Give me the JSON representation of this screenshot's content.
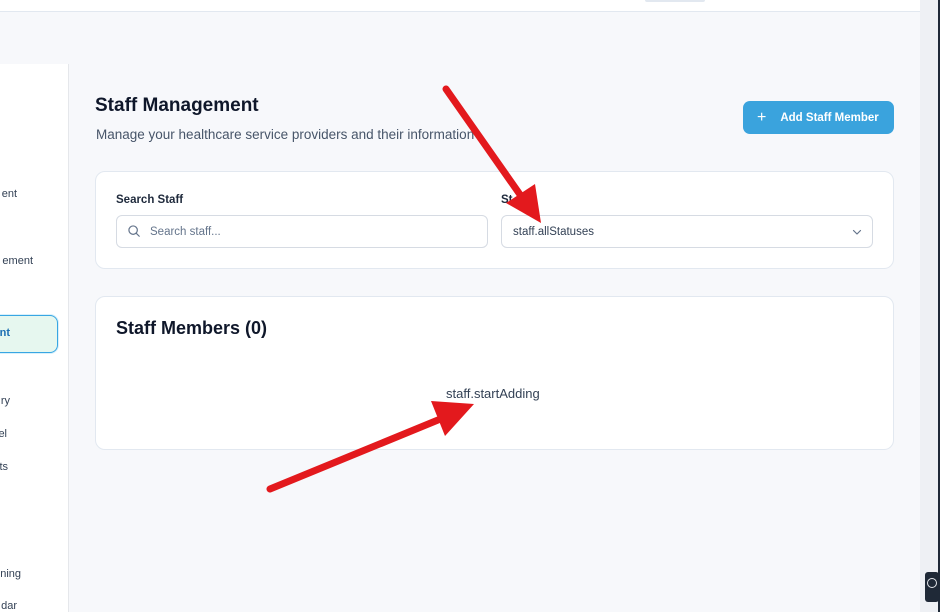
{
  "sidebar": {
    "items": [
      {
        "label": "ent"
      },
      {
        "label": "ement"
      },
      {
        "label": "nt",
        "active": true
      },
      {
        "label": "ry"
      },
      {
        "label": "el"
      },
      {
        "label": "ts"
      },
      {
        "label": "ning"
      },
      {
        "label": "dar"
      }
    ]
  },
  "header": {
    "title": "Staff Management",
    "subtitle": "Manage your healthcare service providers and their information",
    "add_button": {
      "icon": "plus-icon",
      "label": "Add Staff Member"
    }
  },
  "filters": {
    "search_label": "Search Staff",
    "search_placeholder": "Search staff...",
    "search_value": "",
    "status_label": "St",
    "status_value": "staff.allStatuses"
  },
  "members": {
    "title": "Staff Members (0)",
    "empty_text": "staff.startAdding"
  },
  "colors": {
    "accent": "#3aa3dd",
    "active_border": "#38a6e3",
    "active_bg": "#e6f7ef",
    "annotation_arrow": "#e3191d"
  }
}
